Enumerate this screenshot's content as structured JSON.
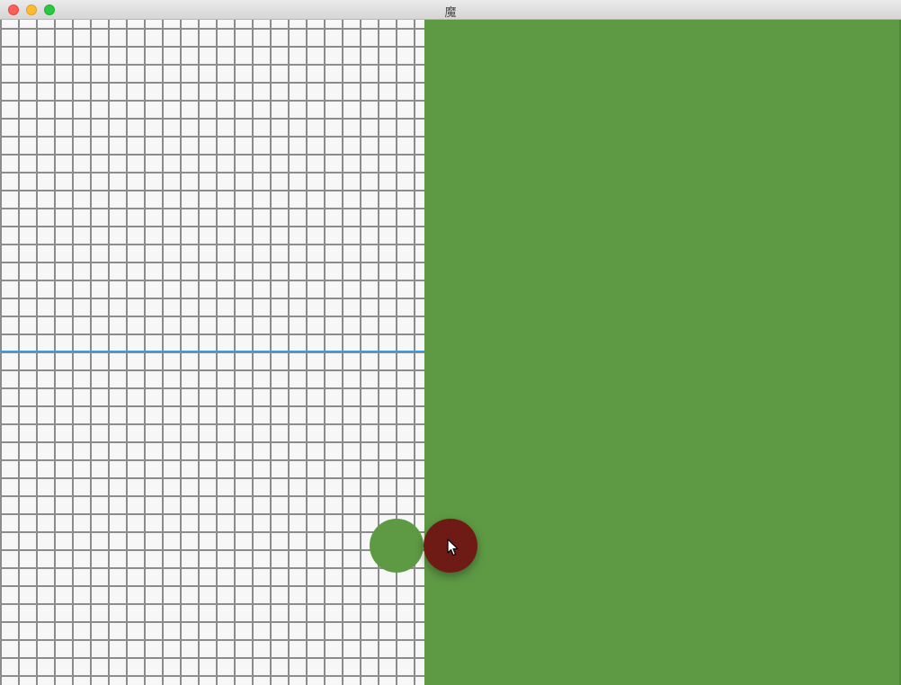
{
  "window": {
    "title": "魔"
  },
  "colors": {
    "grid_background": "#f7f7f7",
    "grid_lines": "#8c8c8c",
    "guide_line": "#3c9be0",
    "green_panel": "#5e9a44",
    "green_ball": "#5e9a44",
    "red_ball": "#6e1a15"
  },
  "icons": {
    "close": "close-button",
    "minimize": "minimize-button",
    "maximize": "maximize-button",
    "cursor": "arrow-cursor-icon"
  }
}
